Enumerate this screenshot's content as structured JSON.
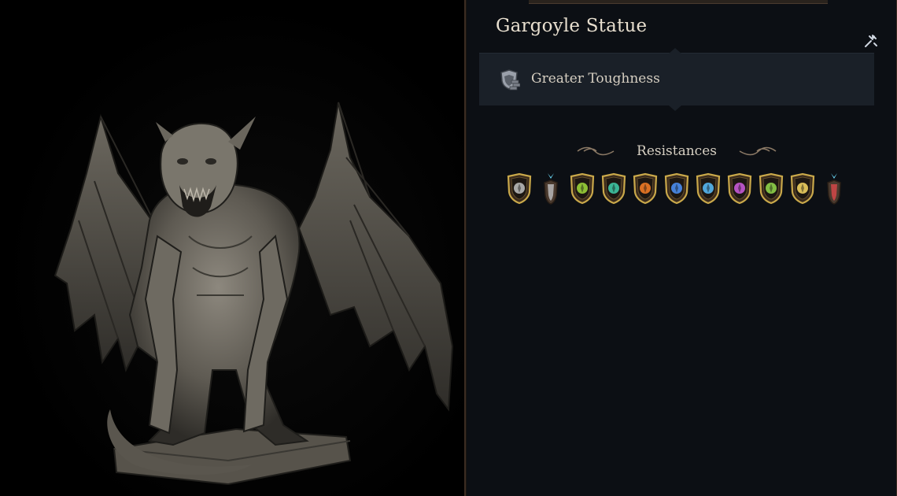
{
  "character": {
    "title": "Gargoyle Statue"
  },
  "passive": {
    "label": "Greater Toughness",
    "icon": "shield-brick-icon"
  },
  "resistances": {
    "title": "Resistances",
    "icons": [
      {
        "name": "slashing-resist-icon",
        "color": "#b9b9b9",
        "style": "shield"
      },
      {
        "name": "piercing-arrow-icon",
        "color": "#b9b9b9",
        "style": "arrow-up"
      },
      {
        "name": "acid-resist-icon",
        "color": "#9bd33a",
        "style": "shield"
      },
      {
        "name": "poison-resist-icon",
        "color": "#3fc6a4",
        "style": "shield"
      },
      {
        "name": "fire-resist-icon",
        "color": "#f07a26",
        "style": "shield"
      },
      {
        "name": "lightning-resist-icon",
        "color": "#4b8df0",
        "style": "shield"
      },
      {
        "name": "cold-resist-icon",
        "color": "#57b7f2",
        "style": "shield"
      },
      {
        "name": "psychic-resist-icon",
        "color": "#c85ad6",
        "style": "shield"
      },
      {
        "name": "necrotic-resist-icon",
        "color": "#8fd14a",
        "style": "shield"
      },
      {
        "name": "radiant-resist-icon",
        "color": "#f0d060",
        "style": "shield"
      },
      {
        "name": "force-arrow-icon",
        "color": "#d24848",
        "style": "arrow-up"
      }
    ]
  },
  "colors": {
    "panel_bg": "#0c0f14",
    "shield_rim": "#c9a84a",
    "shield_fill": "#3a2a1c"
  }
}
